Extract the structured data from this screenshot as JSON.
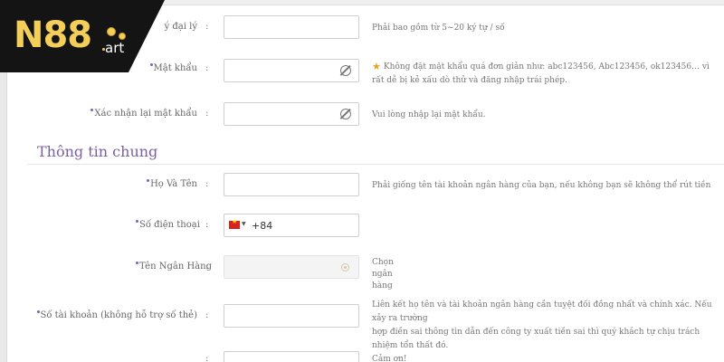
{
  "brand": {
    "logo_main": "N88",
    "logo_sub": "art"
  },
  "form_top": {
    "agent_label": "ý đại lý",
    "agent_hint": "Phải bao gồm từ 5~20 ký tự / số",
    "password_label": "Mật khẩu",
    "password_hint": "Không đặt mật khẩu quá đơn giản như: abc123456, Abc123456, ok123456… vì rất dễ bị kẻ xấu dò thử và đăng nhập trái phép.",
    "confirm_label": "Xác nhận lại mật khẩu",
    "confirm_hint": "Vui lòng nhập lại mật khẩu."
  },
  "section": {
    "title": "Thông tin chung"
  },
  "form_general": {
    "fullname_label": "Họ Và Tên",
    "fullname_hint": "Phải giống tên tài khoản ngân hàng của bạn, nếu không bạn sẽ không thể rút tiền",
    "phone_label": "Số điện thoại",
    "phone_prefix": "+84",
    "bank_label": "Tên Ngân Hàng",
    "bank_hint_1": "Chọn",
    "bank_hint_2": "ngân",
    "bank_hint_3": "hàng",
    "account_label": "Số tài khoản (không hỗ trợ số thẻ)",
    "account_hint_1": "Liên kết họ tên và tài khoản ngân hàng cần tuyệt đối đồng nhất và chính xác. Nếu xảy ra trường",
    "account_hint_2": "hợp điền sai thông tin dẫn đến công ty xuất tiền sai thì quý khách tự chịu trách nhiệm tổn thất đó.",
    "account_hint_3": "Cảm ơn!"
  },
  "colon": ":"
}
